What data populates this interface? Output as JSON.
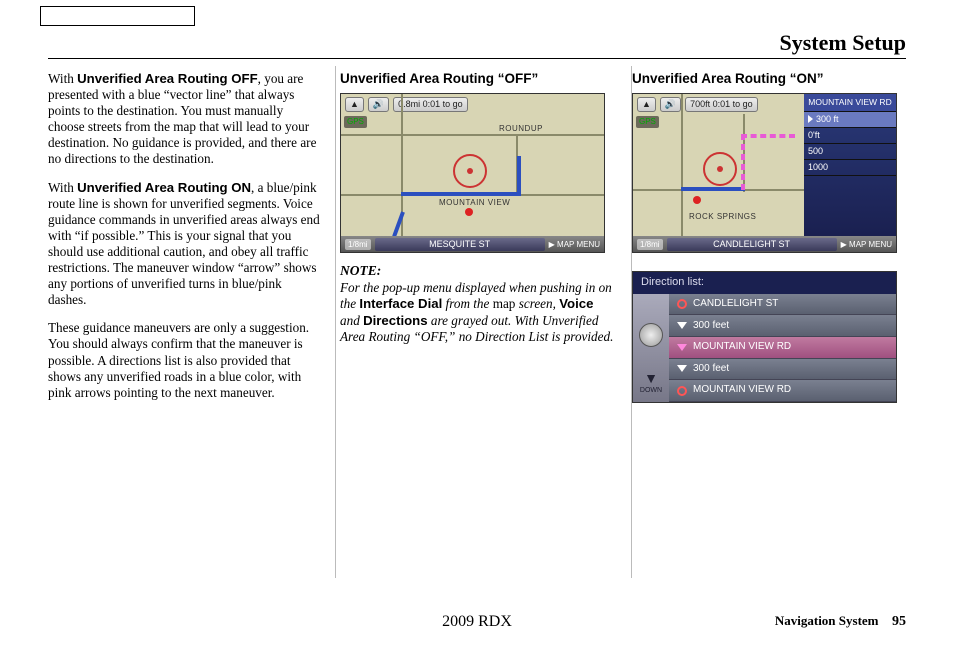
{
  "header": {
    "title": "System Setup"
  },
  "col1": {
    "p1a": "With ",
    "p1b": "Unverified Area Routing OFF",
    "p1c": ", you are presented with a blue “vector line” that always points to the destination. You must manually choose streets from the map that will lead to your destination. No guidance is provided, and there are no directions to the destination.",
    "p2a": "With ",
    "p2b": "Unverified Area Routing ON",
    "p2c": ", a blue/pink route line is shown for unverified segments. Voice guidance commands in unverified areas always end with “if possible.” This is your signal that you should use additional caution, and obey all traffic restrictions. The maneuver window “arrow” shows any portions of unverified turns in blue/pink dashes.",
    "p3": "These guidance maneuvers are only a suggestion. You should always confirm that the maneuver is possible. A directions list is also provided that shows any unverified roads in a blue color, with pink arrows pointing to the next maneuver."
  },
  "col2": {
    "subhead": "Unverified Area Routing “OFF”",
    "map": {
      "north": "▲",
      "dist": "0.8mi 0:01 to go",
      "gps": "GPS",
      "roundup": "ROUNDUP",
      "mtnview": "MOUNTAIN VIEW",
      "scale": "1/8mi",
      "street": "MESQUITE ST",
      "menu": "▶ MAP MENU"
    },
    "note_label": "NOTE:",
    "note1": "For the pop-up menu displayed when pushing in on the ",
    "note_b1": "Interface Dial",
    "note2": " from the ",
    "note_s1": "map",
    "note3": " screen, ",
    "note_b2": "Voice",
    "note4": " and ",
    "note_b3": "Directions",
    "note5": " are grayed out. With Unverified Area Routing “OFF,” no Direction List is provided."
  },
  "col3": {
    "subhead": "Unverified Area Routing “ON”",
    "map": {
      "north": "▲",
      "dist": "700ft 0:01 to go",
      "gps": "GPS",
      "rocksprings": "ROCK SPRINGS",
      "scale": "1/8mi",
      "street": "CANDLELIGHT ST",
      "menu": "▶ MAP MENU",
      "sp_title": "MOUNTAIN VIEW RD",
      "sp_r1": "300 ft",
      "sp_r2": "0'ft",
      "sp_r3": "500",
      "sp_r4": "1000"
    },
    "dirlist": {
      "title": "Direction list:",
      "down": "DOWN",
      "r1": "CANDLELIGHT ST",
      "r2": "300 feet",
      "r3": "MOUNTAIN VIEW RD",
      "r4": "300 feet",
      "r5": "MOUNTAIN VIEW RD"
    }
  },
  "footer": {
    "model": "2009  RDX",
    "navsys": "Navigation System",
    "page": "95"
  }
}
